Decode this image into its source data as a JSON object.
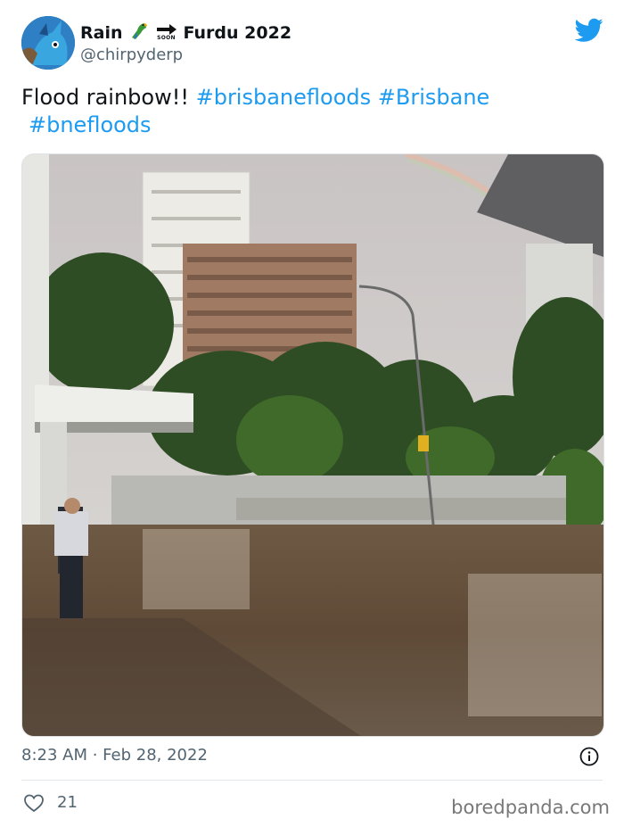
{
  "author": {
    "name_part1": "Rain",
    "name_part2": "Furdu 2022",
    "soon_label": "SOON",
    "handle": "@chirpyderp"
  },
  "tweet": {
    "text": "Flood rainbow!!",
    "hashtags": [
      "#brisbanefloods",
      "#Brisbane",
      "#bnefloods"
    ]
  },
  "meta": {
    "timestamp": "8:23 AM · Feb 28, 2022"
  },
  "actions": {
    "likes": "21"
  },
  "watermark": "boredpanda.com",
  "colors": {
    "accent": "#1d9bf0",
    "muted": "#536471",
    "text": "#0f1419"
  },
  "icons": [
    "twitter-bird-icon",
    "parrot-emoji-icon",
    "soon-arrow-icon",
    "info-icon",
    "heart-icon"
  ]
}
